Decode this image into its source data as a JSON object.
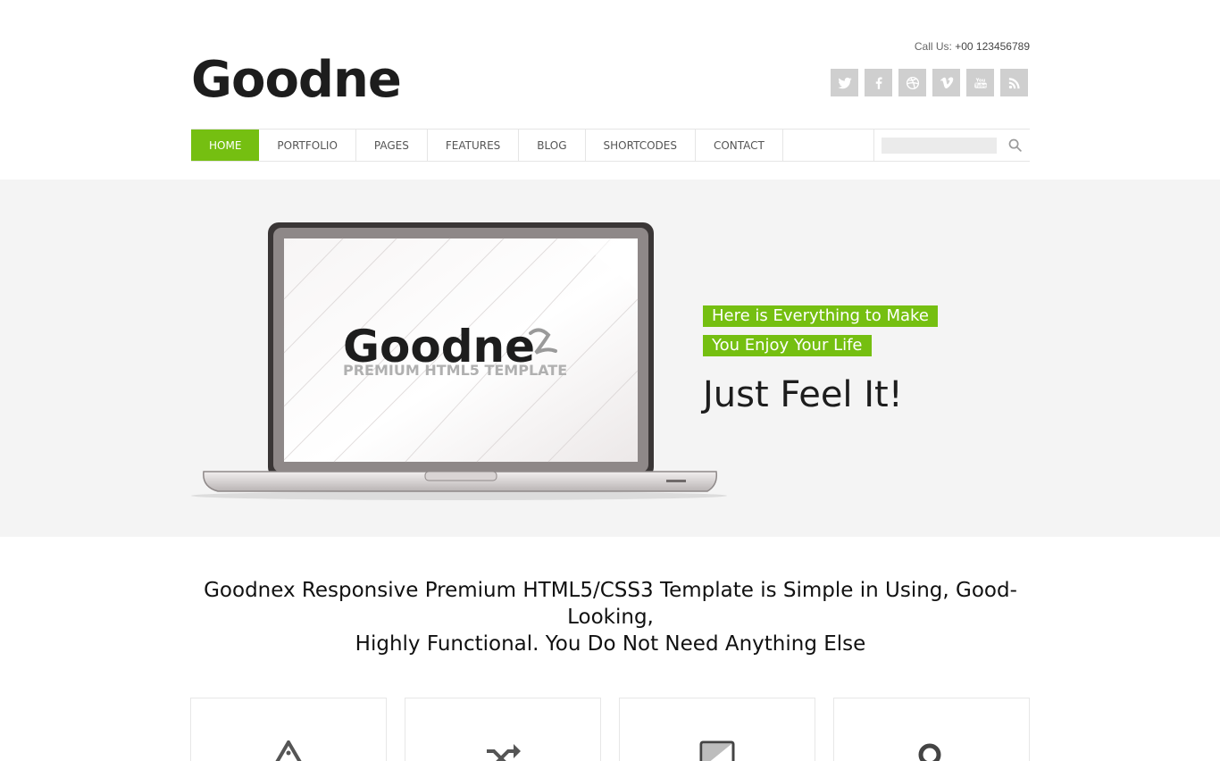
{
  "header": {
    "call_label": "Call Us:",
    "call_number": "+00 123456789",
    "logo": "Goodne",
    "socials": [
      "twitter-icon",
      "facebook-icon",
      "dribbble-icon",
      "vimeo-icon",
      "youtube-icon",
      "rss-icon"
    ]
  },
  "nav": {
    "items": [
      "HOME",
      "PORTFOLIO",
      "PAGES",
      "FEATURES",
      "BLOG",
      "SHORTCODES",
      "CONTACT"
    ],
    "active": "HOME",
    "search_placeholder": ""
  },
  "hero": {
    "screen_logo": "Goodne",
    "screen_subtitle": "PREMIUM HTML5 TEMPLATE",
    "tag1": "Here is Everything to Make",
    "tag2": "You Enjoy Your Life",
    "title": "Just Feel It!"
  },
  "intro": {
    "line1": "Goodnex Responsive Premium HTML5/CSS3 Template is Simple in Using, Good-Looking,",
    "line2": "Highly Functional. You Do Not Need Anything Else"
  },
  "features": {
    "icons": [
      "app-store-icon",
      "shuffle-icon",
      "tablet-icon",
      "search-icon"
    ]
  },
  "colors": {
    "accent": "#75bf11",
    "hero_bg": "#f4f4f4",
    "social_bg": "#cfcfcf"
  }
}
